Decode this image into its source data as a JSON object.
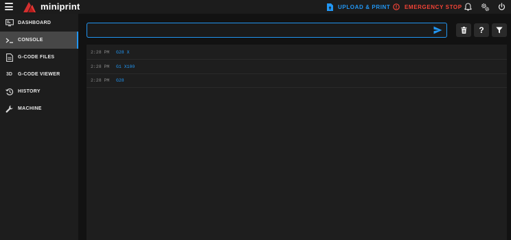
{
  "app": {
    "name": "miniprint"
  },
  "header": {
    "upload_label": "UPLOAD & PRINT",
    "estop_label": "EMERGENCY STOP",
    "colors": {
      "upload": "#2196f3",
      "estop": "#f44336"
    },
    "icons": [
      "menu-icon",
      "logo-icon",
      "upload-file-icon",
      "alert-circle-icon",
      "bell-icon",
      "settings-icon",
      "power-icon"
    ]
  },
  "sidebar": {
    "active": "CONSOLE",
    "items": [
      {
        "label": "DASHBOARD",
        "icon": "monitor-icon"
      },
      {
        "label": "CONSOLE",
        "icon": "terminal-icon"
      },
      {
        "label": "G-CODE FILES",
        "icon": "file-icon"
      },
      {
        "label": "G-CODE VIEWER",
        "icon": "3d-icon",
        "icon_text": "3D"
      },
      {
        "label": "HISTORY",
        "icon": "history-icon"
      },
      {
        "label": "MACHINE",
        "icon": "wrench-icon"
      }
    ]
  },
  "console": {
    "input": {
      "value": "",
      "placeholder": ""
    },
    "toolbar": {
      "clear_icon": "trash-icon",
      "help_label": "?",
      "filter_icon": "filter-icon"
    },
    "entries": [
      {
        "time": "2:28 PM",
        "command": "G28 X"
      },
      {
        "time": "2:28 PM",
        "command": "G1 X100"
      },
      {
        "time": "2:28 PM",
        "command": "G28"
      }
    ]
  }
}
